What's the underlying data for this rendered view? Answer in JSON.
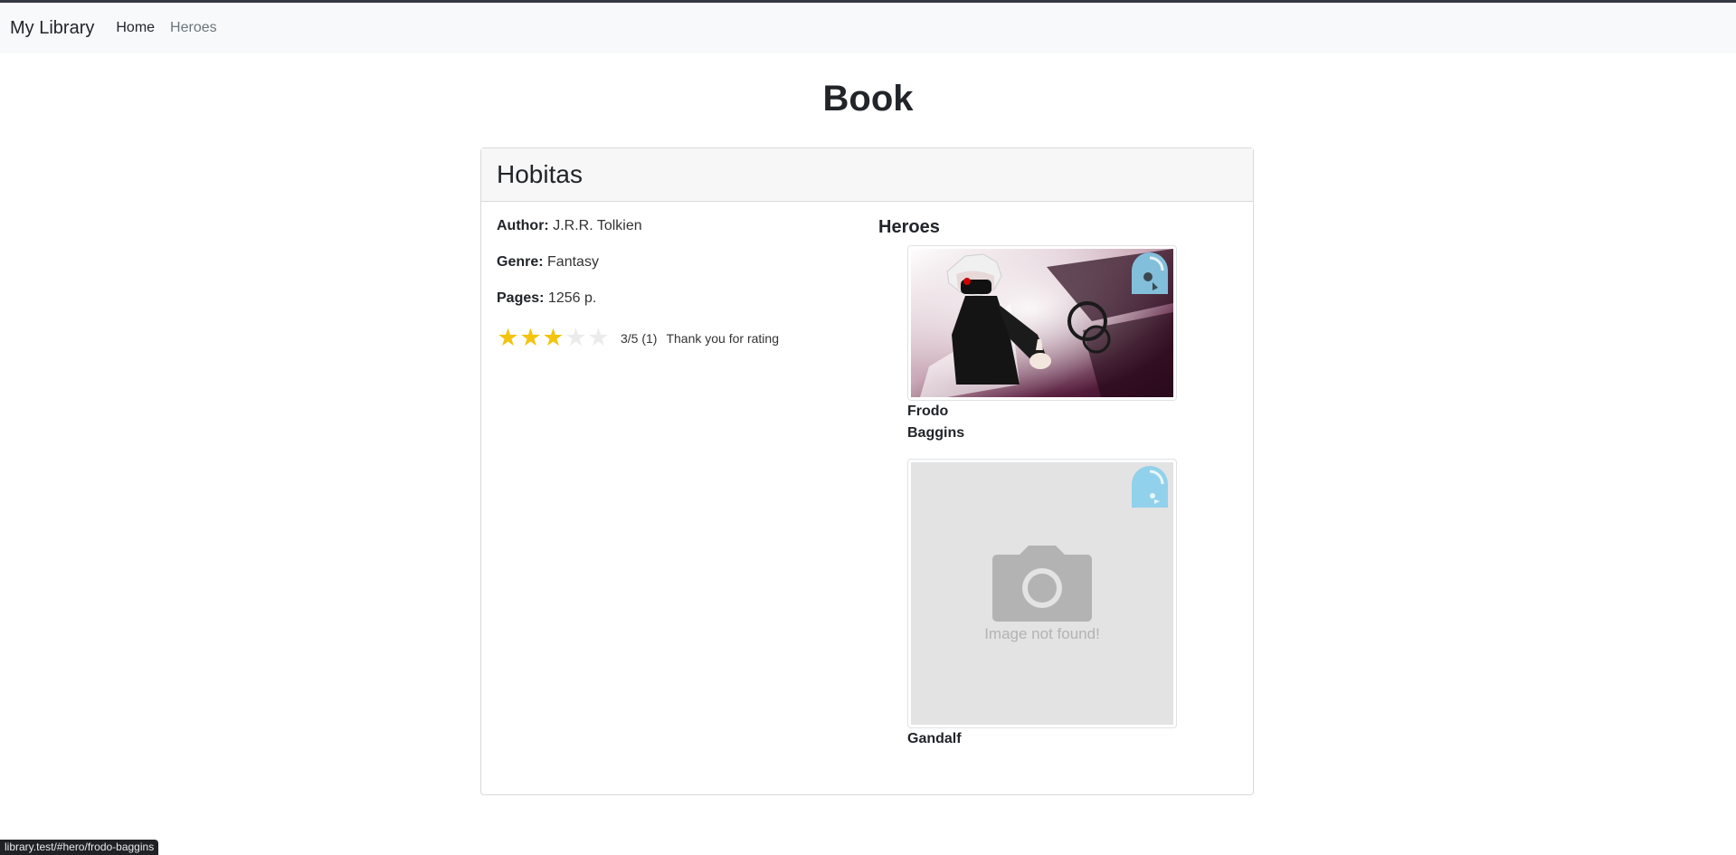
{
  "navbar": {
    "brand": "My Library",
    "links": [
      {
        "label": "Home"
      },
      {
        "label": "Heroes"
      }
    ]
  },
  "page": {
    "title": "Book"
  },
  "book": {
    "title": "Hobitas",
    "author_label": "Author:",
    "author": "J.R.R. Tolkien",
    "genre_label": "Genre:",
    "genre": "Fantasy",
    "pages_label": "Pages:",
    "pages": "1256 p.",
    "rating": {
      "value": 3,
      "max": 5,
      "summary": "3/5 (1)",
      "message": "Thank you for rating"
    }
  },
  "heroes_section": {
    "title": "Heroes",
    "heroes": [
      {
        "name_line1": "Frodo",
        "name_line2": "Baggins",
        "image": "hero-art",
        "favorite_icon": "lock-badge-icon"
      },
      {
        "name_line1": "Gandalf",
        "name_line2": "",
        "image": "placeholder",
        "placeholder_text": "Image not found!",
        "favorite_icon": "lock-badge-icon"
      }
    ]
  },
  "status_bar": {
    "url": "library.test/#hero/frodo-baggins"
  },
  "colors": {
    "star_on": "#f2c40d",
    "star_off": "#ebebeb",
    "badge": "#87ceeb",
    "navbar_bg": "#f8f9fa"
  }
}
